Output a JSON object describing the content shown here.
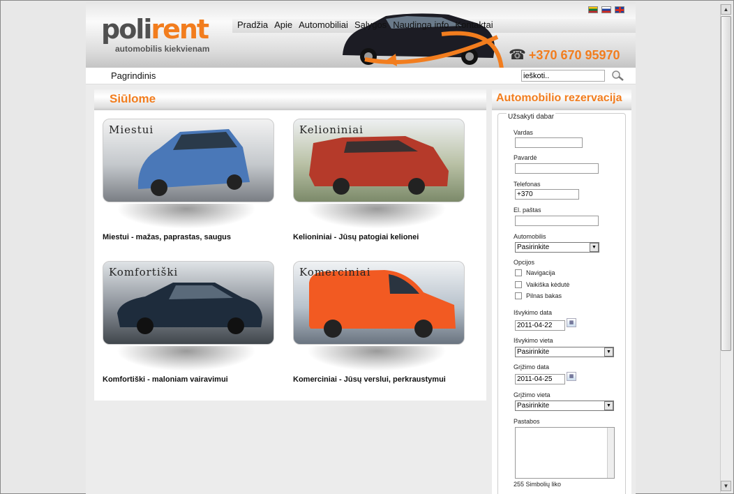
{
  "brand": {
    "logo_part1": "poli",
    "logo_part2": "rent",
    "tagline": "automobilis kiekvienam"
  },
  "nav": [
    "Pradžia",
    "Apie",
    "Automobiliai",
    "Sąlygos",
    "Naudinga info",
    "Kontaktai"
  ],
  "phone": "+370 670 95970",
  "breadcrumb": "Pagrindinis",
  "search": {
    "value": "ieškoti.."
  },
  "offers": {
    "title": "Siūlome",
    "cards": [
      {
        "title": "Miestui",
        "desc": "Miestui - mažas, paprastas, saugus",
        "color": "#4a78b8"
      },
      {
        "title": "Kelioniniai",
        "desc": "Kelioniniai - Jūsų patogiai kelionei",
        "color": "#b53a2a"
      },
      {
        "title": "Komfortiški",
        "desc": "Komfortiški - maloniam vairavimui",
        "color": "#1e2c3c"
      },
      {
        "title": "Komerciniai",
        "desc": "Komerciniai - Jūsų verslui, perkraustymui",
        "color": "#f25a22"
      }
    ]
  },
  "reservation": {
    "title": "Automobilio rezervacija",
    "legend": "Užsakyti dabar",
    "fields": {
      "vardas": "Vardas",
      "pavarde": "Pavardė",
      "telefonas": "Telefonas",
      "telefonas_value": "+370",
      "email": "El. paštas",
      "automobilis": "Automobilis",
      "automobilis_value": "Pasirinkite",
      "opcijos": "Opcijos",
      "opt_nav": "Navigacija",
      "opt_kid": "Vaikiška kėdutė",
      "opt_fuel": "Pilnas bakas",
      "isvykimo_data": "Išvykimo data",
      "isvykimo_data_value": "2011-04-22",
      "isvykimo_vieta": "Išvykimo vieta",
      "isvykimo_vieta_value": "Pasirinkite",
      "grizimo_data": "Grįžimo data",
      "grizimo_data_value": "2011-04-25",
      "grizimo_vieta": "Grįžimo vieta",
      "grizimo_vieta_value": "Pasirinkite",
      "pastabos": "Pastabos",
      "counter": "255 Simbolių liko"
    }
  },
  "colors": {
    "accent": "#f27d1e"
  }
}
